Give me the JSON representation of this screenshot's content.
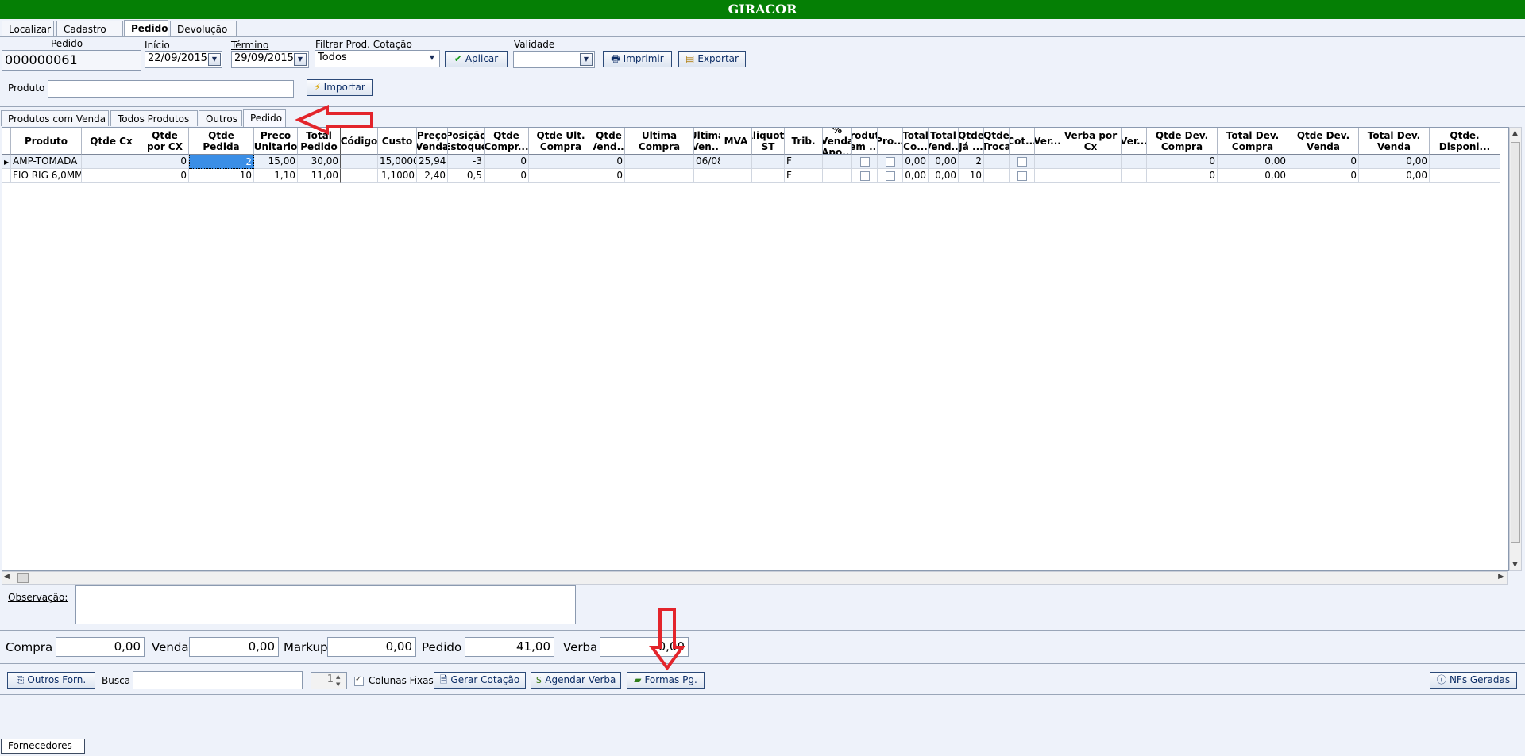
{
  "window": {
    "title": "GIRACOR"
  },
  "main_tabs": [
    "Localizar",
    "Cadastro",
    "Pedido",
    "Devolução"
  ],
  "header": {
    "pedido_label": "Pedido",
    "pedido_value": "000000061",
    "inicio_label": "Início",
    "inicio_value": "22/09/2015",
    "termino_label": "Término",
    "termino_value": "29/09/2015",
    "filtrar_label": "Filtrar Prod. Cotação",
    "filtrar_value": "Todos",
    "aplicar": "Aplicar",
    "validade_label": "Validade",
    "validade_value": "",
    "imprimir": "Imprimir",
    "exportar": "Exportar"
  },
  "produto": {
    "label": "Produto",
    "value": "",
    "importar": "Importar"
  },
  "sub_tabs": [
    "Produtos com Venda",
    "Todos Produtos",
    "Outros",
    "Pedido"
  ],
  "grid": {
    "columns": [
      "",
      "Produto",
      "Qtde Cx",
      "Qtde\npor CX",
      "Qtde\nPedida",
      "Preco\nUnitario",
      "Total\nPedido",
      "Código",
      "Custo",
      "Preço\nVenda",
      "Posição\nEstoque",
      "Qtde\nCompr...",
      "Qtde Ult.\nCompra",
      "Qtde\nVend...",
      "Ultima\nCompra",
      "Ultima\nVen...",
      "MVA",
      "Aliquota\nST",
      "Trib.",
      "% Venda\nApo...",
      "Produto\nem ...",
      "Pro...",
      "Total\nCo...",
      "Total\nVend...",
      "Qtde\nJá ...",
      "Qtde\nTroca",
      "Cot...",
      "Ver...",
      "Verba por Cx",
      "Ver...",
      "Qtde Dev.\nCompra",
      "Total Dev.\nCompra",
      "Qtde Dev.\nVenda",
      "Total Dev.\nVenda",
      "Qtde. Disponi..."
    ],
    "rows": [
      [
        "",
        "AMP-TOMADA F",
        "",
        "0",
        "2",
        "15,00",
        "30,00",
        "",
        "15,0000",
        "25,94",
        "-3",
        "0",
        "",
        "0",
        "",
        "06/08",
        "",
        "",
        "F",
        "",
        "",
        "",
        "0,00",
        "0,00",
        "2",
        "",
        "",
        "",
        "",
        "",
        "0",
        "0,00",
        "0",
        "0,00",
        ""
      ],
      [
        "",
        "FIO RIG 6,0MM",
        "",
        "0",
        "10",
        "1,10",
        "11,00",
        "",
        "1,1000",
        "2,40",
        "0,5",
        "0",
        "",
        "0",
        "",
        "",
        "",
        "",
        "F",
        "",
        "",
        "",
        "0,00",
        "0,00",
        "10",
        "",
        "",
        "",
        "",
        "",
        "0",
        "0,00",
        "0",
        "0,00",
        ""
      ]
    ]
  },
  "observacao": {
    "label": "Observação:",
    "value": ""
  },
  "totals": {
    "compra_label": "Compra",
    "compra_value": "0,00",
    "venda_label": "Venda",
    "venda_value": "0,00",
    "markup_label": "Markup",
    "markup_value": "0,00",
    "pedido_label": "Pedido",
    "pedido_value": "41,00",
    "verba_label": "Verba",
    "verba_value": "0,00"
  },
  "bottom_bar": {
    "outros_forn": "Outros Forn.",
    "busca_label": "Busca",
    "busca_value": "",
    "spinner_value": "1",
    "colunas_fixas": "Colunas Fixas",
    "gerar_cotacao": "Gerar Cotação",
    "agendar_verba": "Agendar Verba",
    "formas_pg": "Formas Pg.",
    "nfs_geradas": "NFs Geradas"
  },
  "footer_tab": "Fornecedores",
  "colors": {
    "title_bar": "#057f05",
    "annotation_arrow": "#e3242b",
    "selected_cell": "#3a8ee6"
  }
}
